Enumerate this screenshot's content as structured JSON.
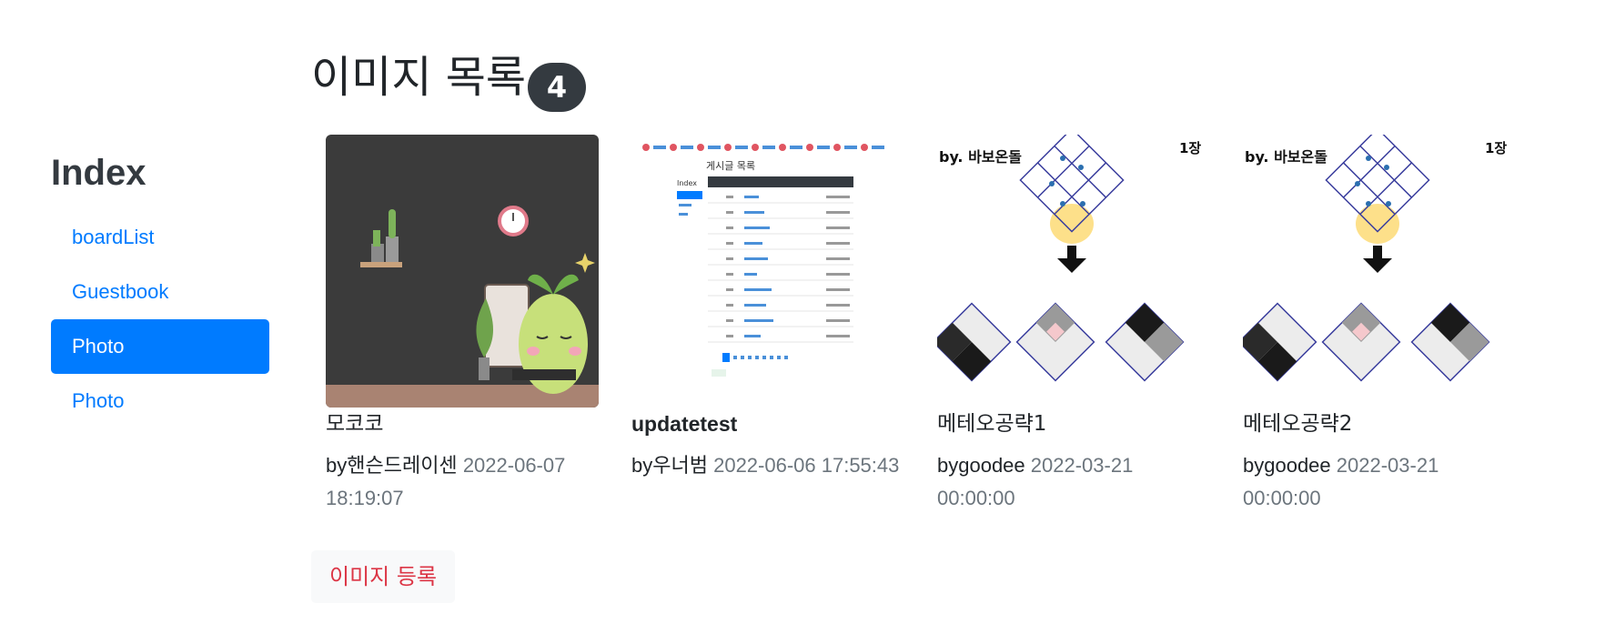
{
  "sidebar": {
    "title": "Index",
    "items": [
      {
        "label": "boardList",
        "active": false
      },
      {
        "label": "Guestbook",
        "active": false
      },
      {
        "label": "Photo",
        "active": true
      },
      {
        "label": "Photo",
        "active": false
      }
    ]
  },
  "main": {
    "title": "이미지 목록",
    "count": "4",
    "register_label": "이미지 등록",
    "cards": [
      {
        "title": "모코코",
        "by": "by핸슨드레이센",
        "date": "2022-06-07 18:19:07",
        "image": "green-mascot-at-computer"
      },
      {
        "title": "updatetest",
        "by": "by우너범",
        "date": "2022-06-06 17:55:43",
        "image": "board-list-screenshot"
      },
      {
        "title": "메테오공략1",
        "by": "bygoodee",
        "date": "2022-03-21 00:00:00",
        "image": "diamond-puzzle-guide"
      },
      {
        "title": "메테오공략2",
        "by": "bygoodee",
        "date": "2022-03-21 00:00:00",
        "image": "diamond-puzzle-guide"
      }
    ]
  },
  "thumbnails": {
    "board": {
      "heading": "게시글 목록",
      "sidebar_title": "Index"
    },
    "puzzle": {
      "author": "by. 바보온돌",
      "page": "1장"
    }
  }
}
